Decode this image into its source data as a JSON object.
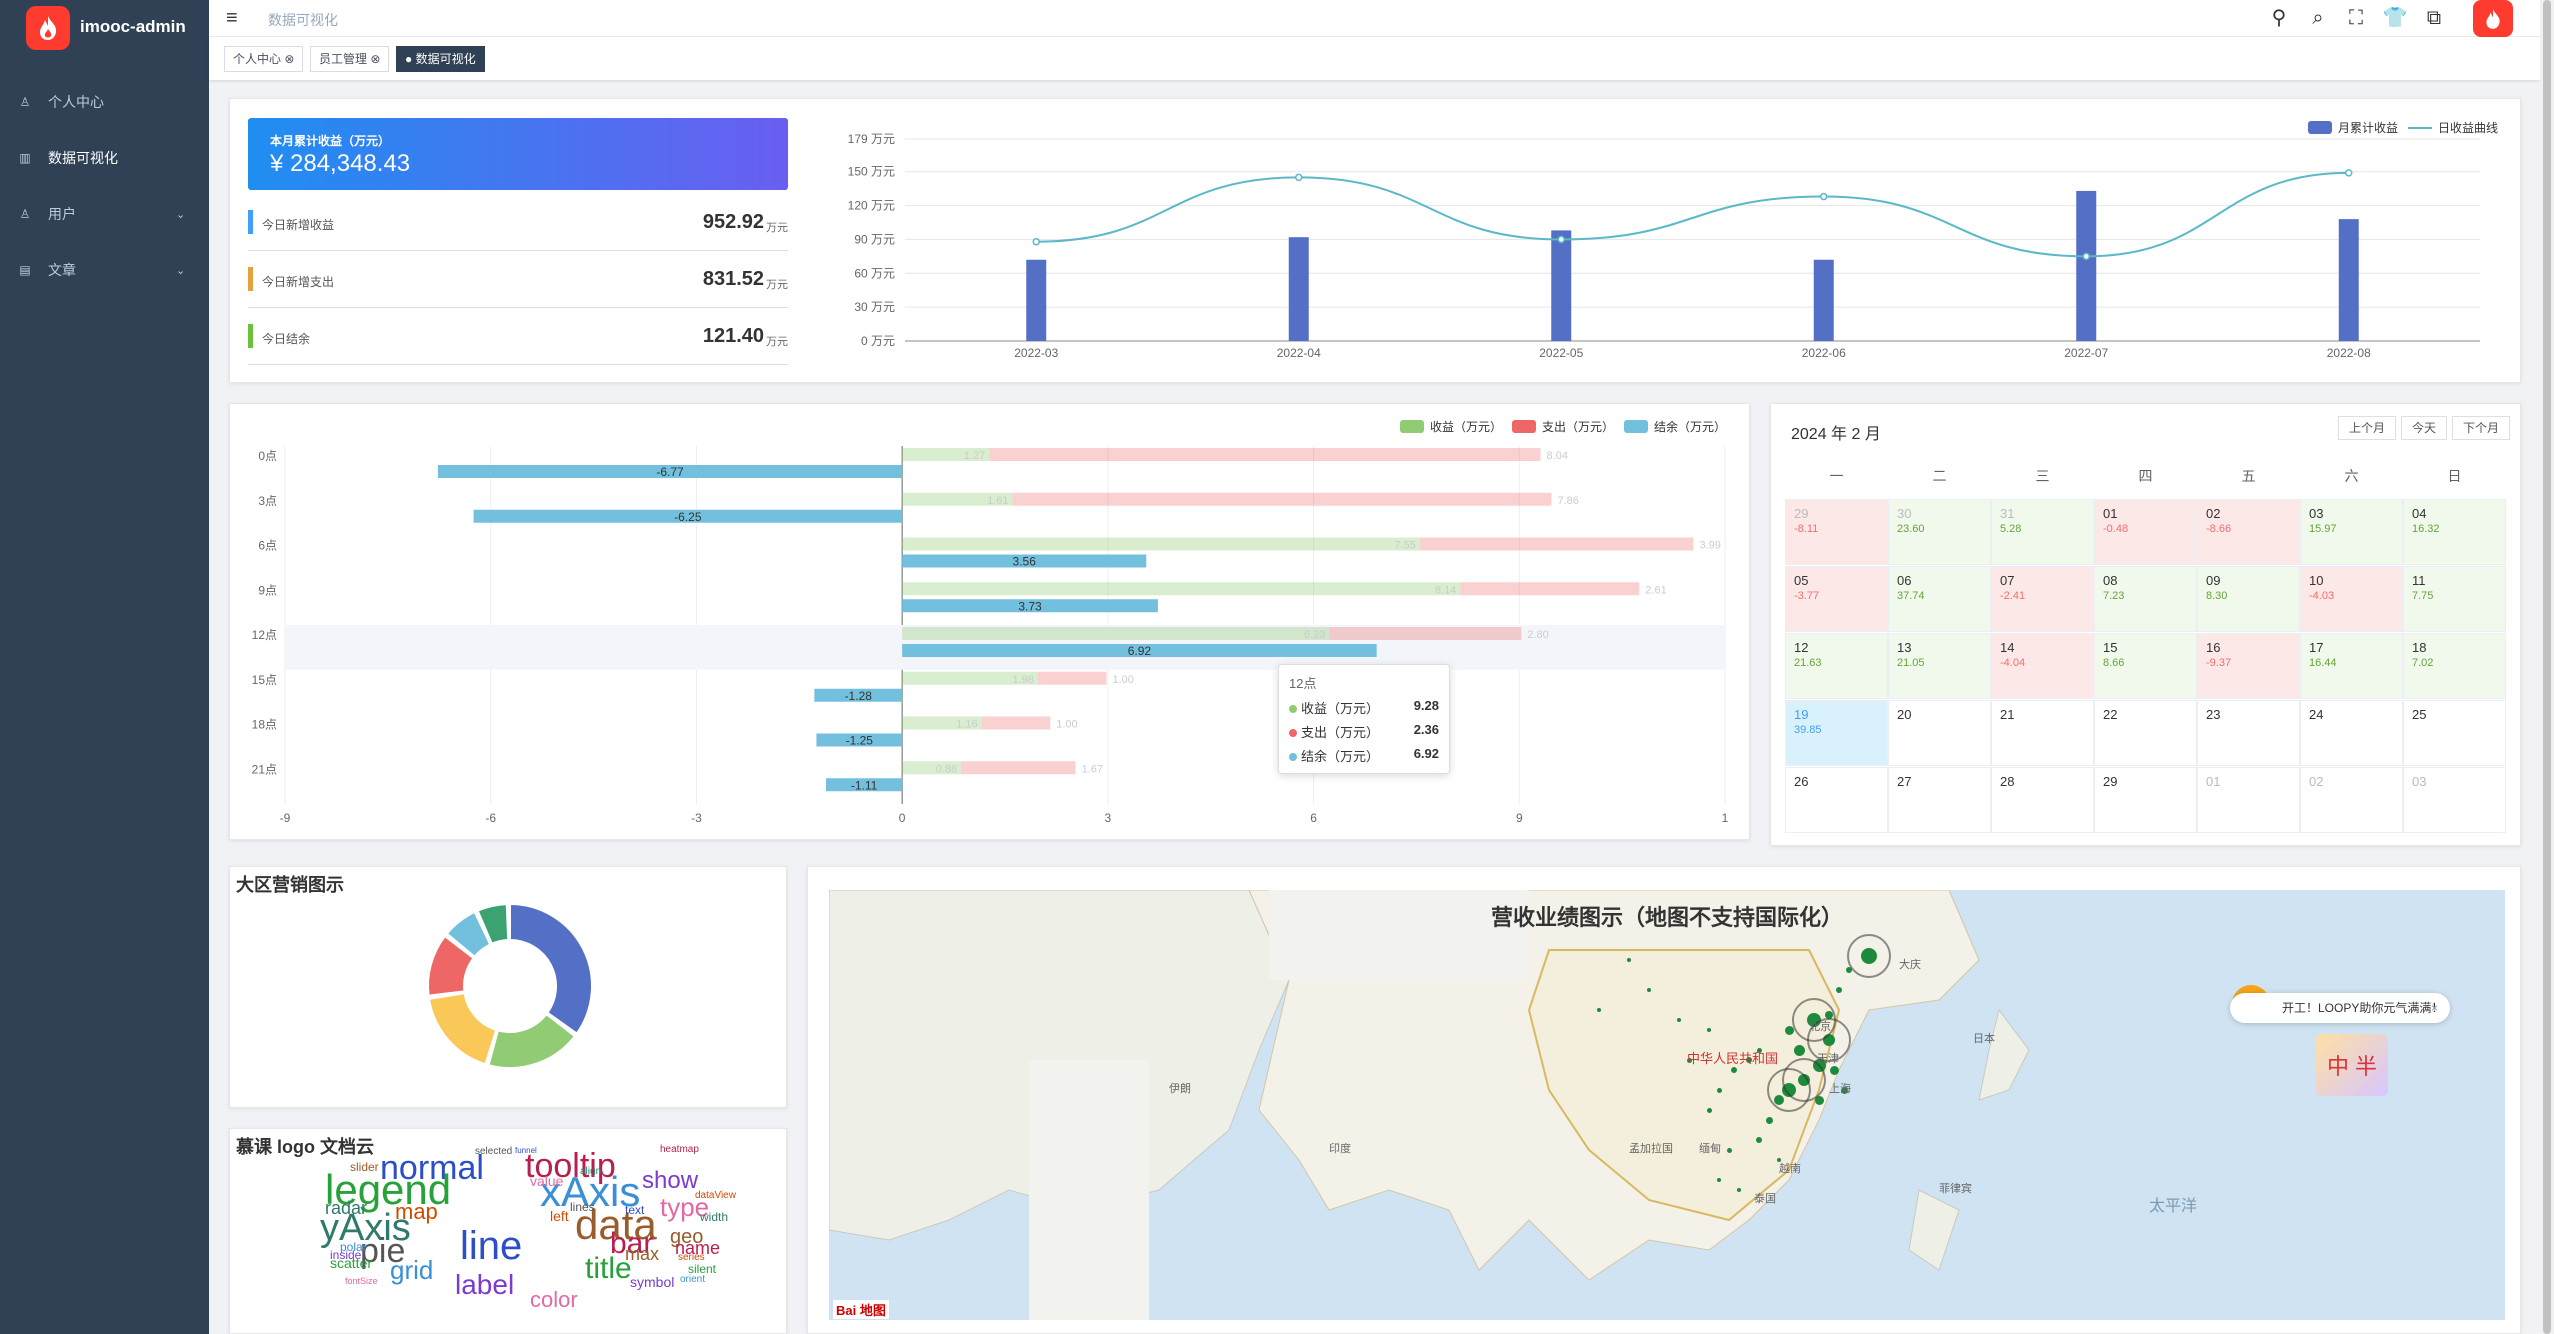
{
  "app": {
    "name": "imooc-admin"
  },
  "sidebar": {
    "items": [
      {
        "label": "个人中心",
        "icon": "user-icon"
      },
      {
        "label": "数据可视化",
        "icon": "chart-icon",
        "active": true
      },
      {
        "label": "用户",
        "icon": "user-group-icon",
        "expandable": true
      },
      {
        "label": "文章",
        "icon": "article-icon",
        "expandable": true
      }
    ]
  },
  "navbar": {
    "breadcrumb": "数据可视化",
    "icons": [
      "guide-icon",
      "search-icon",
      "fullscreen-icon",
      "theme-icon",
      "language-icon"
    ]
  },
  "tags": [
    {
      "label": "个人中心 ⊗"
    },
    {
      "label": "员工管理 ⊗"
    },
    {
      "label": "● 数据可视化",
      "active": true
    }
  ],
  "summary": {
    "title": "本月累计收益（万元）",
    "value": "¥ 284,348.43",
    "rows": [
      {
        "label": "今日新增收益",
        "value": "952.92",
        "unit": "万元",
        "color": "#409eff"
      },
      {
        "label": "今日新增支出",
        "value": "831.52",
        "unit": "万元",
        "color": "#e6a23c"
      },
      {
        "label": "今日结余",
        "value": "121.40",
        "unit": "万元",
        "color": "#67c23a"
      }
    ]
  },
  "chart_data": [
    {
      "type": "bar+line",
      "categories": [
        "2022-03",
        "2022-04",
        "2022-05",
        "2022-06",
        "2022-07",
        "2022-08"
      ],
      "series": [
        {
          "name": "月累计收益",
          "type": "bar",
          "values": [
            72,
            92,
            98,
            72,
            133,
            108
          ],
          "color": "#5470c6"
        },
        {
          "name": "日收益曲线",
          "type": "line",
          "values": [
            88,
            145,
            90,
            128,
            75,
            149
          ],
          "color": "#5ab8c7"
        }
      ],
      "yticks": [
        "0 万元",
        "30 万元",
        "60 万元",
        "90 万元",
        "120 万元",
        "150 万元",
        "179 万元"
      ],
      "ylim": [
        0,
        179
      ],
      "legend": "top-right"
    },
    {
      "type": "bar",
      "orientation": "horizontal",
      "categories": [
        "0点",
        "3点",
        "6点",
        "9点",
        "12点",
        "15点",
        "18点",
        "21点"
      ],
      "series": [
        {
          "name": "收益（万元）",
          "values": [
            1.27,
            1.61,
            7.55,
            8.14,
            6.23,
            1.98,
            1.16,
            0.86
          ],
          "color": "#91cc75"
        },
        {
          "name": "支出（万元）",
          "values": [
            8.04,
            7.86,
            3.99,
            2.61,
            2.8,
            1.0,
            1.0,
            1.67
          ],
          "color": "#ee6666"
        },
        {
          "name": "结余（万元）",
          "values": [
            -6.77,
            -6.25,
            3.56,
            3.73,
            6.92,
            -1.28,
            -1.25,
            -1.11
          ],
          "color": "#73c0de"
        }
      ],
      "xticks": [
        "-9",
        "-6",
        "-3",
        "0",
        "3",
        "6",
        "9",
        "1"
      ],
      "xlim": [
        -9,
        12
      ],
      "legend": "top-right",
      "tooltip": {
        "title": "12点",
        "rows": [
          {
            "label": "收益（万元）",
            "value": "9.28",
            "color": "#91cc75"
          },
          {
            "label": "支出（万元）",
            "value": "2.36",
            "color": "#ee6666"
          },
          {
            "label": "结余（万元）",
            "value": "6.92",
            "color": "#73c0de"
          }
        ]
      }
    },
    {
      "type": "pie",
      "title": "大区营销图示",
      "values": [
        33,
        18,
        17,
        12,
        7,
        6
      ],
      "colors": [
        "#5470c6",
        "#91cc75",
        "#fac858",
        "#ee6666",
        "#73c0de",
        "#3ba272"
      ]
    }
  ],
  "calendar": {
    "title": "2024 年 2 月",
    "buttons": [
      "上个月",
      "今天",
      "下个月"
    ],
    "weekdays": [
      "一",
      "二",
      "三",
      "四",
      "五",
      "六",
      "日"
    ],
    "cells": [
      {
        "d": "29",
        "v": "-8.11",
        "s": "neg",
        "o": true
      },
      {
        "d": "30",
        "v": "23.60",
        "s": "pos",
        "o": true
      },
      {
        "d": "31",
        "v": "5.28",
        "s": "pos",
        "o": true
      },
      {
        "d": "01",
        "v": "-0.48",
        "s": "neg"
      },
      {
        "d": "02",
        "v": "-8.66",
        "s": "neg"
      },
      {
        "d": "03",
        "v": "15.97",
        "s": "pos"
      },
      {
        "d": "04",
        "v": "16.32",
        "s": "pos"
      },
      {
        "d": "05",
        "v": "-3.77",
        "s": "neg"
      },
      {
        "d": "06",
        "v": "37.74",
        "s": "pos"
      },
      {
        "d": "07",
        "v": "-2.41",
        "s": "neg"
      },
      {
        "d": "08",
        "v": "7.23",
        "s": "pos"
      },
      {
        "d": "09",
        "v": "8.30",
        "s": "pos"
      },
      {
        "d": "10",
        "v": "-4.03",
        "s": "neg"
      },
      {
        "d": "11",
        "v": "7.75",
        "s": "pos"
      },
      {
        "d": "12",
        "v": "21.63",
        "s": "pos"
      },
      {
        "d": "13",
        "v": "21.05",
        "s": "pos"
      },
      {
        "d": "14",
        "v": "-4.04",
        "s": "neg"
      },
      {
        "d": "15",
        "v": "8.66",
        "s": "pos"
      },
      {
        "d": "16",
        "v": "-9.37",
        "s": "neg"
      },
      {
        "d": "17",
        "v": "16.44",
        "s": "pos"
      },
      {
        "d": "18",
        "v": "7.02",
        "s": "pos"
      },
      {
        "d": "19",
        "v": "39.85",
        "s": "today"
      },
      {
        "d": "20",
        "v": ""
      },
      {
        "d": "21",
        "v": ""
      },
      {
        "d": "22",
        "v": ""
      },
      {
        "d": "23",
        "v": ""
      },
      {
        "d": "24",
        "v": ""
      },
      {
        "d": "25",
        "v": ""
      },
      {
        "d": "26",
        "v": ""
      },
      {
        "d": "27",
        "v": ""
      },
      {
        "d": "28",
        "v": ""
      },
      {
        "d": "29",
        "v": ""
      },
      {
        "d": "01",
        "v": "",
        "o": true
      },
      {
        "d": "02",
        "v": "",
        "o": true
      },
      {
        "d": "03",
        "v": "",
        "o": true
      }
    ]
  },
  "wordcloud": {
    "title": "慕课 logo 文档云",
    "words": [
      "normal",
      "tooltip",
      "legend",
      "xAxis",
      "show",
      "type",
      "yAxis",
      "data",
      "map",
      "pie",
      "line",
      "bar",
      "title",
      "grid",
      "label",
      "color",
      "radar",
      "geo",
      "series",
      "selected",
      "funnel",
      "heatmap",
      "scatter",
      "polar",
      "inside",
      "value",
      "align",
      "slider",
      "left",
      "lines",
      "text",
      "name",
      "silent",
      "orient",
      "symbol",
      "fontSize",
      "width",
      "max",
      "dataView"
    ]
  },
  "map": {
    "title": "营收业绩图示（地图不支持国际化）",
    "labels": [
      "大庆",
      "北京",
      "天津",
      "上海",
      "中华人民共和国",
      "太平洋",
      "日本",
      "伊朗",
      "印度",
      "泰国",
      "越南",
      "孟加拉国",
      "缅甸",
      "菲律宾"
    ],
    "attribution": "Bai 地图"
  },
  "promo": {
    "text": "开工！LOOPY助你元气满满！",
    "close": "×",
    "badge": "中 半"
  }
}
